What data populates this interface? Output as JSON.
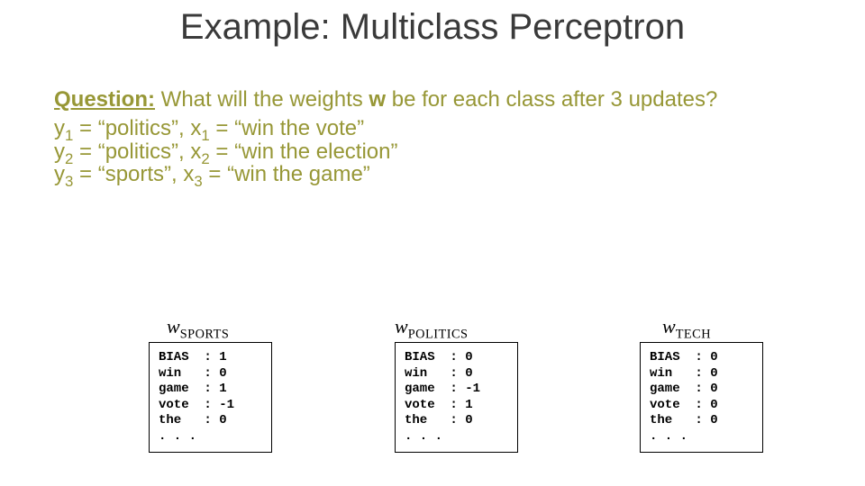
{
  "title": "Example: Multiclass Perceptron",
  "question_label": "Question:",
  "question_text": " What will the weights ",
  "question_emph": "w",
  "question_tail": " be for each class after 3 updates?",
  "ex1_pre": "y",
  "ex1_sub": "1",
  "ex1_mid": " = “politics”,  x",
  "ex1_sub2": "1",
  "ex1_tail": " = “win the vote”",
  "ex2_pre": "y",
  "ex2_sub": "2",
  "ex2_mid": " = “politics”, x",
  "ex2_sub2": "2",
  "ex2_tail": " = “win the election”",
  "ex3_pre": "y",
  "ex3_sub": "3",
  "ex3_mid": " = “sports”, x",
  "ex3_sub2": "3",
  "ex3_tail": " = “win the game”",
  "w_sports_sym": "w",
  "w_sports_sub": "SPORTS",
  "w_politics_sym": "w",
  "w_politics_sub": "POLITICS",
  "w_tech_sym": "w",
  "w_tech_sub": "TECH",
  "box_sports": "BIAS  : 1\nwin   : 0\ngame  : 1\nvote  : -1\nthe   : 0\n. . .",
  "box_politics": "BIAS  : 0\nwin   : 0\ngame  : -1\nvote  : 1\nthe   : 0\n. . .",
  "box_tech": "BIAS  : 0\nwin   : 0\ngame  : 0\nvote  : 0\nthe   : 0\n. . .",
  "chart_data": {
    "type": "table",
    "tables": [
      {
        "name": "w_SPORTS",
        "rows": [
          {
            "feature": "BIAS",
            "value": 1
          },
          {
            "feature": "win",
            "value": 0
          },
          {
            "feature": "game",
            "value": 1
          },
          {
            "feature": "vote",
            "value": -1
          },
          {
            "feature": "the",
            "value": 0
          }
        ]
      },
      {
        "name": "w_POLITICS",
        "rows": [
          {
            "feature": "BIAS",
            "value": 0
          },
          {
            "feature": "win",
            "value": 0
          },
          {
            "feature": "game",
            "value": -1
          },
          {
            "feature": "vote",
            "value": 1
          },
          {
            "feature": "the",
            "value": 0
          }
        ]
      },
      {
        "name": "w_TECH",
        "rows": [
          {
            "feature": "BIAS",
            "value": 0
          },
          {
            "feature": "win",
            "value": 0
          },
          {
            "feature": "game",
            "value": 0
          },
          {
            "feature": "vote",
            "value": 0
          },
          {
            "feature": "the",
            "value": 0
          }
        ]
      }
    ]
  }
}
